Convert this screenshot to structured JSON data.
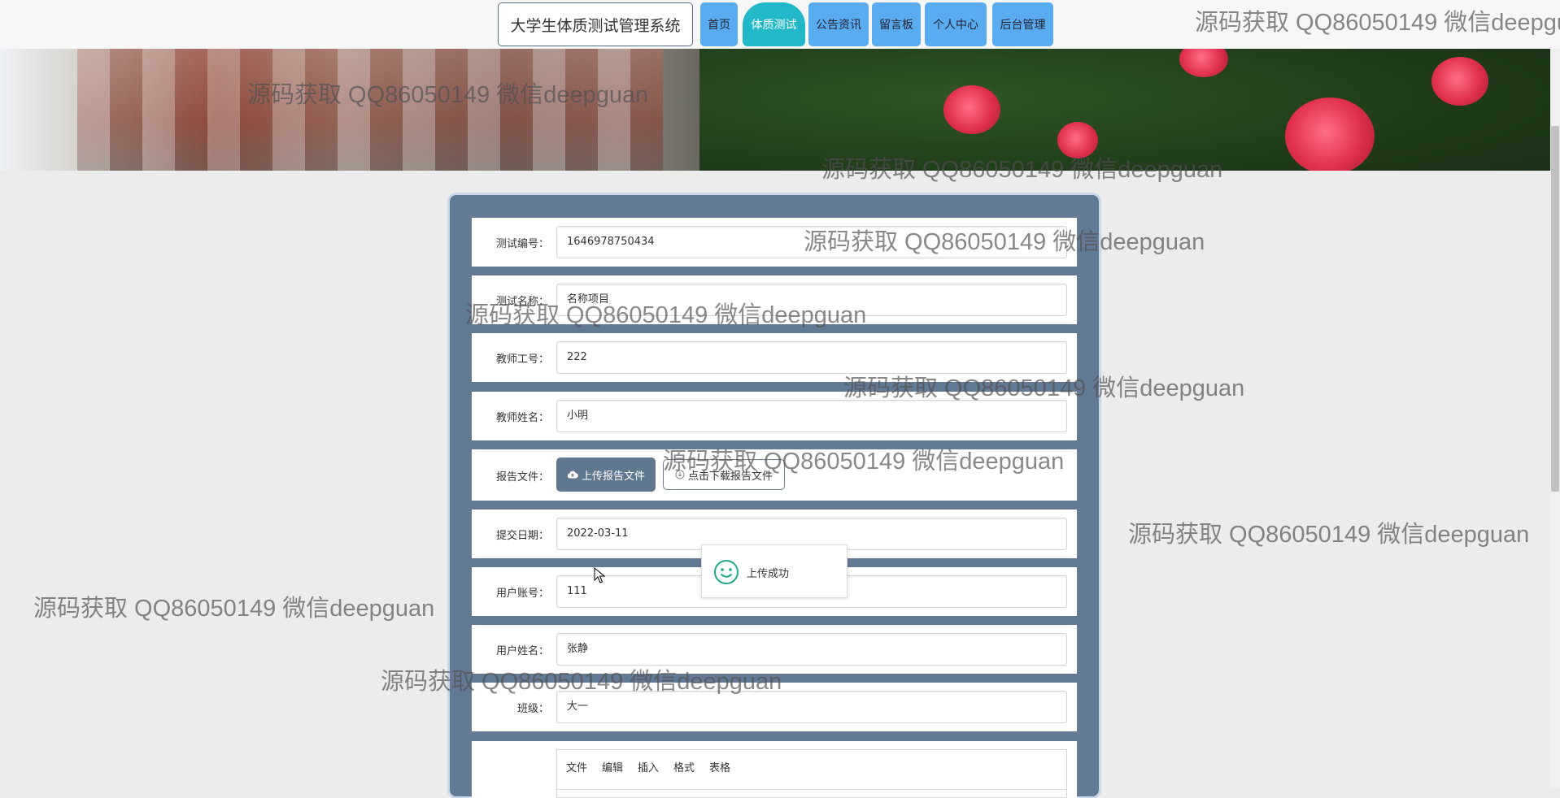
{
  "nav": {
    "brand": "大学生体质测试管理系统",
    "items": [
      "首页",
      "体质测试",
      "公告资讯",
      "留言板",
      "个人中心",
      "后台管理"
    ],
    "active": "体质测试"
  },
  "form": {
    "test_no": {
      "label": "测试编号：",
      "value": "1646978750434"
    },
    "test_name": {
      "label": "测试名称：",
      "value": "名称项目"
    },
    "teacher_no": {
      "label": "教师工号：",
      "value": "222"
    },
    "teacher_name": {
      "label": "教师姓名：",
      "value": "小明"
    },
    "report": {
      "label": "报告文件：",
      "upload_label": "上传报告文件",
      "download_label": "点击下载报告文件"
    },
    "submit_date": {
      "label": "提交日期：",
      "value": "2022-03-11"
    },
    "user_account": {
      "label": "用户账号：",
      "value": "111"
    },
    "user_name": {
      "label": "用户姓名：",
      "value": "张静"
    },
    "class": {
      "label": "班级：",
      "value": "大一"
    },
    "editor_menu": [
      "文件",
      "编辑",
      "插入",
      "格式",
      "表格"
    ]
  },
  "toast": {
    "text": "上传成功"
  },
  "watermark": "源码获取 QQ86050149 微信deepguan",
  "colors": {
    "nav_button": "#5aacf0",
    "nav_active": "#22b8c8",
    "card_bg": "#627a93",
    "upload_button": "#5f7890"
  }
}
